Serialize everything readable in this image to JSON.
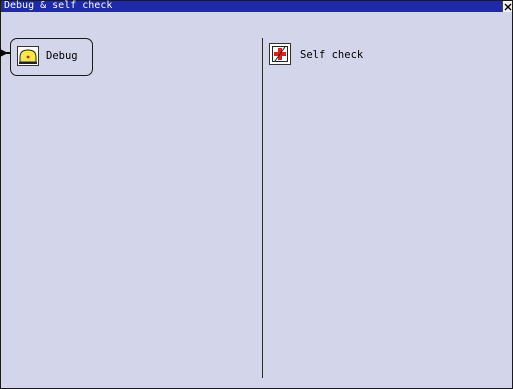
{
  "window": {
    "title": "Debug & self check"
  },
  "menu": {
    "debug_label": "Debug",
    "self_check_label": "Self check"
  },
  "colors": {
    "title_bar": "#1e2aa8",
    "window_bg": "#d3d5ea",
    "debug_icon_fill": "#f5e94a",
    "self_check_icon_cross": "#e0201c"
  },
  "icons": {
    "close": "close-icon",
    "debug": "debug-icon",
    "self_check": "self-check-icon",
    "pointer": "pointer-arrow-icon"
  }
}
